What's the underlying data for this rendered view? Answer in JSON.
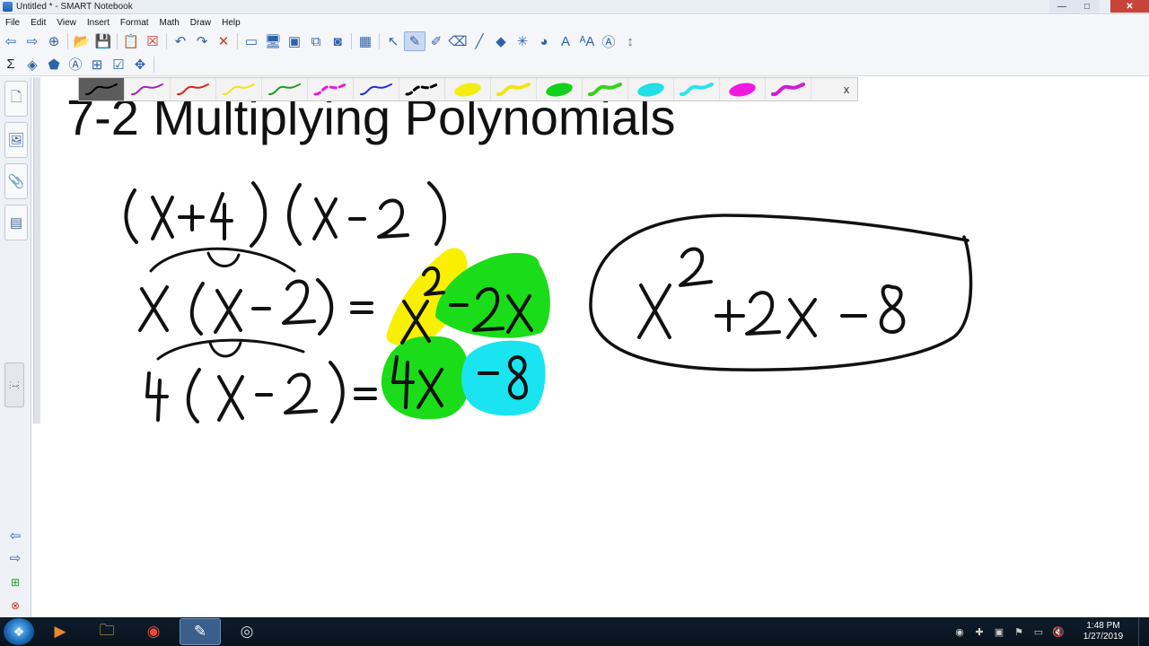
{
  "window": {
    "title": "Untitled * - SMART Notebook"
  },
  "menu": [
    "File",
    "Edit",
    "View",
    "Insert",
    "Format",
    "Math",
    "Draw",
    "Help"
  ],
  "toolbar1": [
    {
      "name": "back-icon",
      "glyph": "⇦"
    },
    {
      "name": "forward-icon",
      "glyph": "⇨"
    },
    {
      "name": "add-page-icon",
      "glyph": "⊕"
    },
    {
      "name": "open-file-icon",
      "glyph": "📂"
    },
    {
      "name": "save-icon",
      "glyph": "💾"
    },
    {
      "name": "paste-icon",
      "glyph": "📋"
    },
    {
      "name": "delete-page-icon",
      "glyph": "☒"
    },
    {
      "name": "undo-icon",
      "glyph": "↶"
    },
    {
      "name": "redo-icon",
      "glyph": "↷"
    },
    {
      "name": "delete-icon",
      "glyph": "✕"
    },
    {
      "name": "screen-shade-icon",
      "glyph": "▭"
    },
    {
      "name": "full-screen-icon",
      "glyph": "🖥"
    },
    {
      "name": "dual-page-icon",
      "glyph": "▣"
    },
    {
      "name": "screen-capture-icon",
      "glyph": "⧉"
    },
    {
      "name": "document-camera-icon",
      "glyph": "◙"
    },
    {
      "name": "table-icon",
      "glyph": "▦"
    },
    {
      "name": "select-icon",
      "glyph": "↖"
    },
    {
      "name": "pen-icon",
      "glyph": "✎"
    },
    {
      "name": "creative-pen-icon",
      "glyph": "✐"
    },
    {
      "name": "eraser-icon",
      "glyph": "⌫"
    },
    {
      "name": "line-icon",
      "glyph": "╱"
    },
    {
      "name": "shapes-icon",
      "glyph": "◆"
    },
    {
      "name": "magic-pen-icon",
      "glyph": "✳"
    },
    {
      "name": "fill-icon",
      "glyph": "◕"
    },
    {
      "name": "text-icon",
      "glyph": "A"
    },
    {
      "name": "text-format-icon",
      "glyph": "ᴬA"
    },
    {
      "name": "properties-icon",
      "glyph": "Ⓐ"
    },
    {
      "name": "move-toolbar-icon",
      "glyph": "↕"
    }
  ],
  "toolbar2": [
    {
      "name": "math-sigma-icon",
      "glyph": "Σ"
    },
    {
      "name": "shape-recognition-icon",
      "glyph": "◈"
    },
    {
      "name": "pen-recognition-icon",
      "glyph": "⬟"
    },
    {
      "name": "fill-selection-icon",
      "glyph": "Ⓐ"
    },
    {
      "name": "table-format-icon",
      "glyph": "⊞"
    },
    {
      "name": "check-icon",
      "glyph": "☑"
    },
    {
      "name": "measurement-icon",
      "glyph": "✥"
    }
  ],
  "pens": [
    {
      "name": "pen-black",
      "color": "#000000",
      "style": "solid",
      "width": 2,
      "selected": true
    },
    {
      "name": "pen-purple",
      "color": "#9b26b6",
      "style": "solid",
      "width": 2
    },
    {
      "name": "pen-red",
      "color": "#e0201a",
      "style": "solid",
      "width": 2
    },
    {
      "name": "pen-yellow",
      "color": "#f3e11a",
      "style": "solid",
      "width": 2
    },
    {
      "name": "pen-green",
      "color": "#1f9b1f",
      "style": "solid",
      "width": 2
    },
    {
      "name": "pen-magenta-dashed",
      "color": "#e81ad8",
      "style": "dashed",
      "width": 3
    },
    {
      "name": "pen-blue",
      "color": "#1c2fd6",
      "style": "solid",
      "width": 2
    },
    {
      "name": "pen-black-dashed",
      "color": "#000000",
      "style": "dashed",
      "width": 3
    },
    {
      "name": "highlighter-yellow-blob",
      "color": "#f5ec12",
      "style": "blob",
      "width": 10
    },
    {
      "name": "highlighter-yellow",
      "color": "#f2e31a",
      "style": "solid",
      "width": 4
    },
    {
      "name": "highlighter-green-blob",
      "color": "#12d11a",
      "style": "blob",
      "width": 10
    },
    {
      "name": "highlighter-green",
      "color": "#36d11a",
      "style": "solid",
      "width": 4
    },
    {
      "name": "highlighter-cyan-blob",
      "color": "#20e0e6",
      "style": "blob",
      "width": 10
    },
    {
      "name": "highlighter-cyan",
      "color": "#2ee1f0",
      "style": "solid",
      "width": 4
    },
    {
      "name": "highlighter-magenta-blob",
      "color": "#f019e0",
      "style": "blob",
      "width": 10
    },
    {
      "name": "highlighter-magenta",
      "color": "#d21ad6",
      "style": "solid",
      "width": 4
    }
  ],
  "penbar_close": "x",
  "canvas": {
    "heading": "7-2 Multiplying Polynomials"
  },
  "taskbar": {
    "apps": [
      {
        "name": "media-player-icon",
        "glyph": "▶"
      },
      {
        "name": "file-explorer-icon",
        "glyph": "🗀"
      },
      {
        "name": "chrome-icon",
        "glyph": "◉"
      },
      {
        "name": "smart-notebook-icon",
        "glyph": "✎",
        "active": true
      },
      {
        "name": "obs-icon",
        "glyph": "◎"
      }
    ],
    "tray": [
      {
        "name": "tray-icon-1",
        "glyph": "◉"
      },
      {
        "name": "tray-icon-2",
        "glyph": "✚"
      },
      {
        "name": "tray-icon-3",
        "glyph": "▣"
      },
      {
        "name": "tray-icon-4",
        "glyph": "⚑"
      },
      {
        "name": "tray-icon-5",
        "glyph": "▭"
      },
      {
        "name": "volume-muted-icon",
        "glyph": "🔇"
      }
    ],
    "time": "1:48 PM",
    "date": "1/27/2019"
  }
}
